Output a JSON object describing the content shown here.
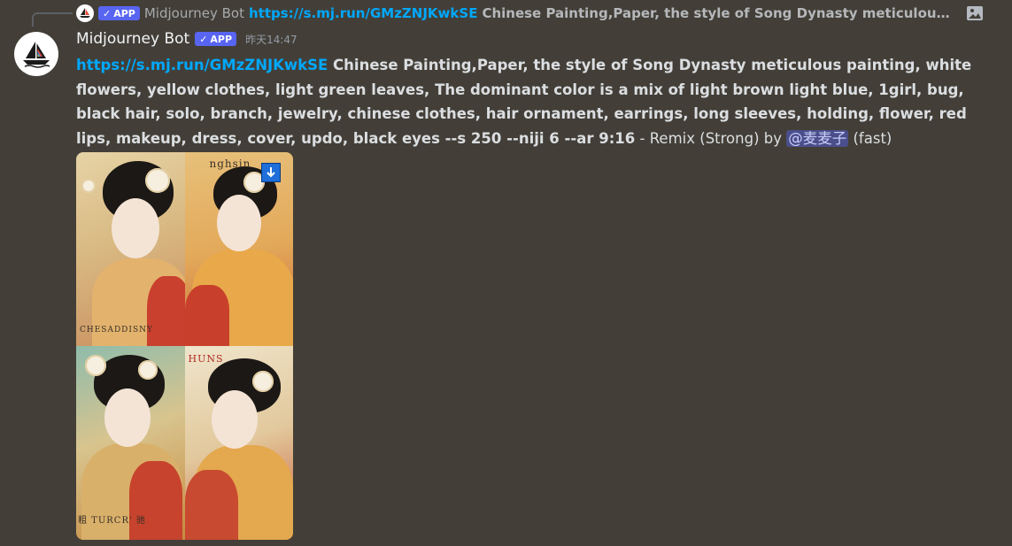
{
  "reply": {
    "author": "Midjourney Bot",
    "badge": "APP",
    "link": "https://s.mj.run/GMzZNJKwkSE",
    "text": "Chinese Painting,Paper, the style of Song Dynasty meticulous painti…",
    "icon": "image-icon"
  },
  "message": {
    "author": "Midjourney Bot",
    "badge": "APP",
    "timestamp": "昨天14:47",
    "link": "https://s.mj.run/GMzZNJKwkSE",
    "prompt": " Chinese Painting,Paper, the style of Song Dynasty meticulous painting, white flowers, yellow clothes, light green leaves, The dominant color is a mix of light brown light blue, 1girl, bug, black hair, solo, branch, jewelry, chinese clothes, hair ornament, earrings, long sleeves, holding, flower, red lips, makeup, dress, cover, updo, black eyes --s 250 --niji 6 --ar 9:16",
    "meta_prefix": " - Remix (Strong) by ",
    "mention": "@麦麦子",
    "meta_suffix": " (fast)"
  },
  "image_grid": {
    "tile_texts": {
      "t1_bottom": "CHESADDISNY",
      "t2_top": "nghsin",
      "t3_bottom": "粗 TURCR' 驰",
      "t4_top": "HUNS"
    },
    "download_icon": "download-arrow-icon"
  },
  "colors": {
    "background": "#433f38",
    "link": "#00a8fc",
    "badge": "#5865f2",
    "mention_bg": "#4a4e8a"
  }
}
